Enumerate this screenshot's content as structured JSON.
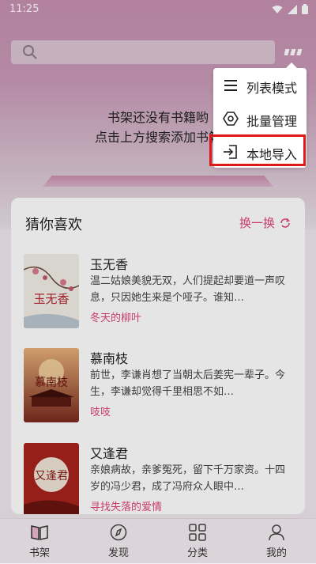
{
  "status_bar": {
    "time": "11:25"
  },
  "search": {
    "placeholder": ""
  },
  "empty_state": {
    "line1": "书架还没有书籍哟",
    "line2": "点击上方搜索添加书籍"
  },
  "popup_menu": {
    "items": [
      {
        "label": "列表模式",
        "icon": "list-icon"
      },
      {
        "label": "批量管理",
        "icon": "hexagon-settings-icon"
      },
      {
        "label": "本地导入",
        "icon": "import-icon",
        "highlighted": true
      }
    ]
  },
  "recommend": {
    "title": "猜你喜欢",
    "refresh_label": "换一换",
    "books": [
      {
        "title": "玉无香",
        "desc": "温二姑娘美貌无双，人们提起却要道一声叹息，只因她生来是个哑子。谁知…",
        "author": "冬天的柳叶",
        "cover_title": "玉无香"
      },
      {
        "title": "慕南枝",
        "desc": "前世，李谦肖想了当朝太后姜宪一辈子。今生，李谦却觉得千里相思不如…",
        "author": "吱吱",
        "cover_title": "慕南枝"
      },
      {
        "title": "又逢君",
        "desc": "亲娘病故，亲爹冤死，留下千万家资。十四岁的冯少君，成了冯府众人眼中…",
        "author": "寻找失落的爱情",
        "cover_title": "又逢君"
      }
    ]
  },
  "tabs": [
    {
      "label": "书架",
      "icon": "book-icon",
      "active": true
    },
    {
      "label": "发现",
      "icon": "compass-icon"
    },
    {
      "label": "分类",
      "icon": "grid-icon"
    },
    {
      "label": "我的",
      "icon": "user-icon"
    }
  ],
  "colors": {
    "accent": "#e0457b",
    "highlight_box": "#e01818"
  }
}
